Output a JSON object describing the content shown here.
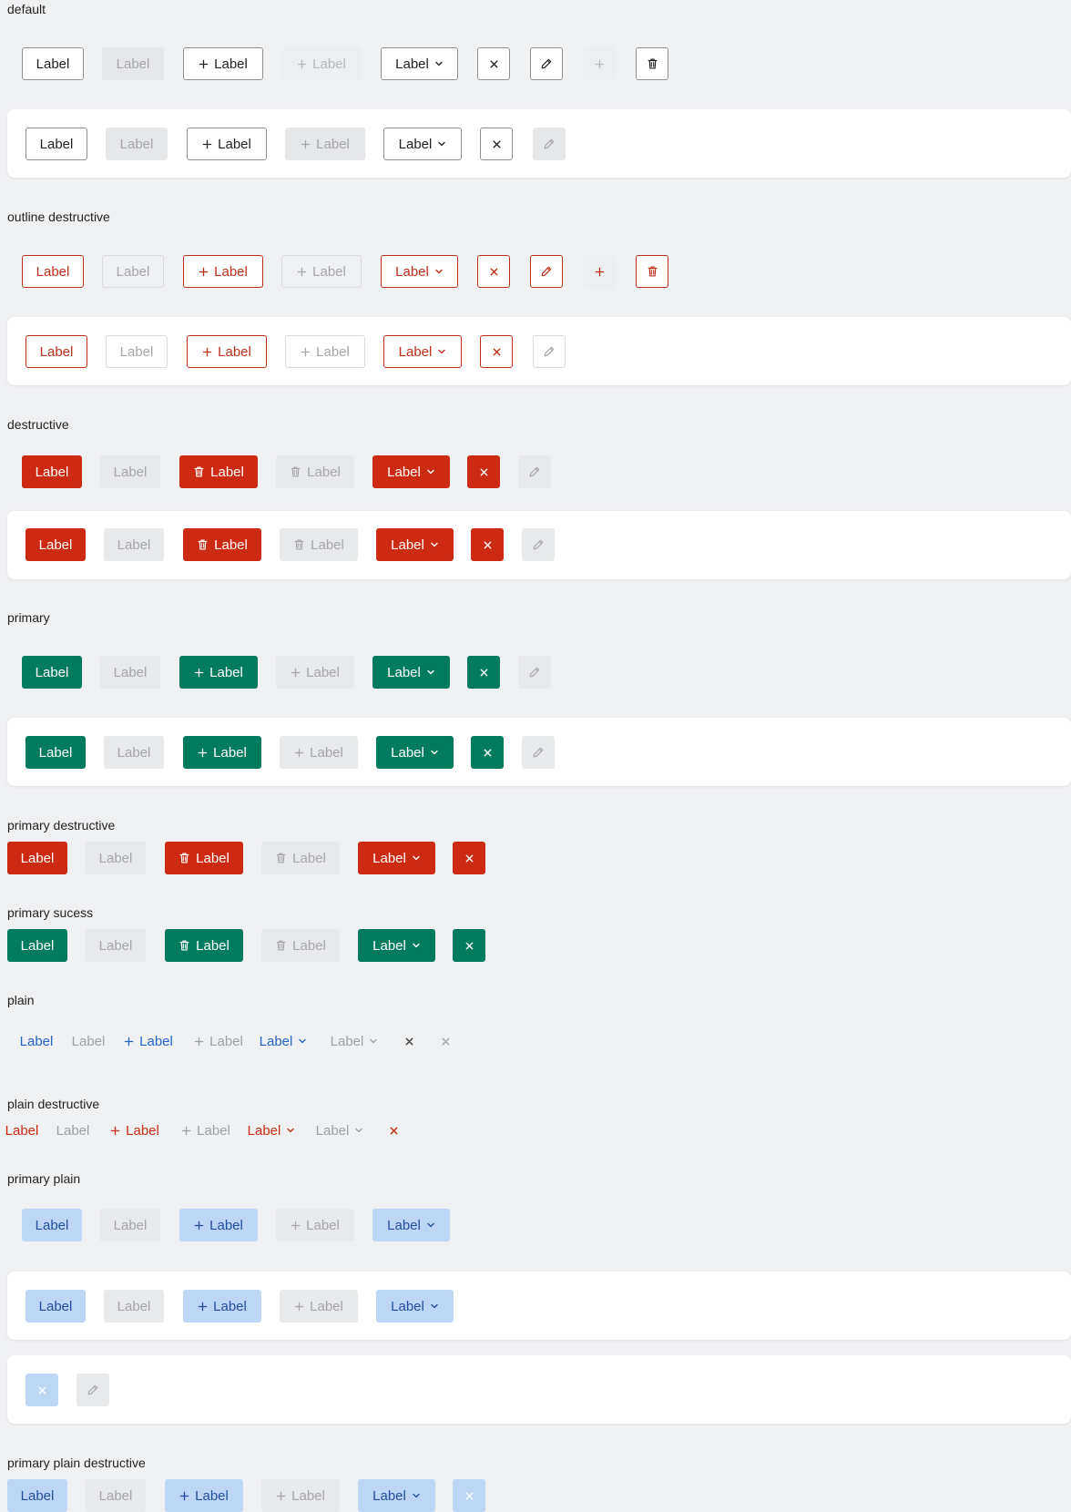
{
  "button_label": "Label",
  "sections": {
    "default": "default",
    "outline_destructive": "outline destructive",
    "destructive": "destructive",
    "primary": "primary",
    "primary_destructive": "primary destructive",
    "primary_success": "primary sucess",
    "plain": "plain",
    "plain_destructive": "plain destructive",
    "primary_plain": "primary plain",
    "primary_plain_destructive": "primary plain destructive"
  },
  "icons": {
    "add": "plus-icon",
    "dropdown": "chevron-down-icon",
    "close": "close-icon",
    "edit": "pencil-icon",
    "delete": "trash-icon"
  },
  "colors": {
    "page_background": "#f0f1f3",
    "panel_background": "#ffffff",
    "destructive": "#cc2a12",
    "primary": "#007b5e",
    "plain_link": "#2563c7",
    "primary_plain": "#bed6f6",
    "disabled": "#e8e9eb"
  }
}
